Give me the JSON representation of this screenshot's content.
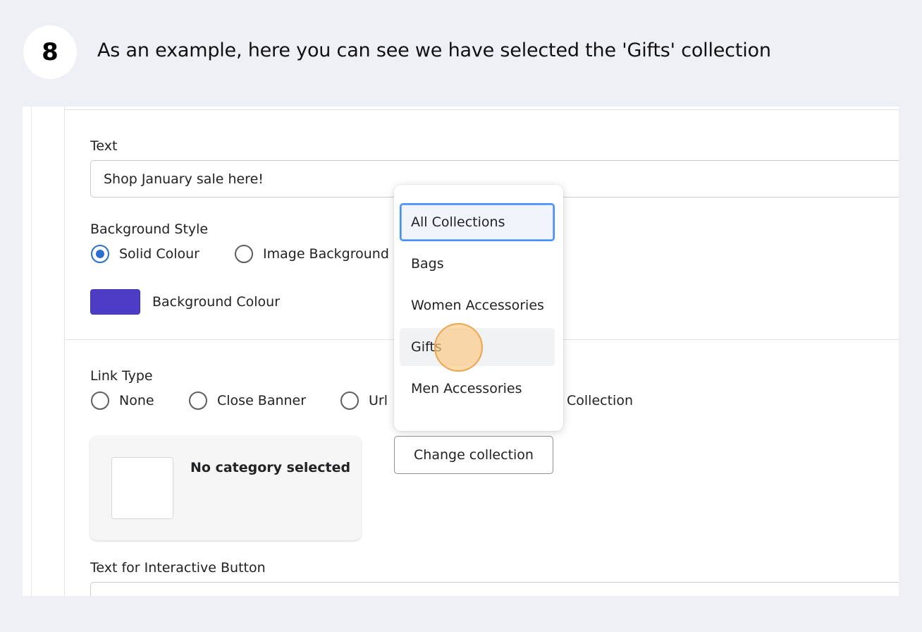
{
  "step": {
    "number": "8",
    "instruction": "As an example, here you can see we have selected the 'Gifts' collection"
  },
  "form": {
    "text_label": "Text",
    "text_value": "Shop January sale here!",
    "background_style_label": "Background Style",
    "background_options": [
      {
        "label": "Solid Colour",
        "checked": true
      },
      {
        "label": "Image Background",
        "checked": false
      }
    ],
    "background_colour_label": "Background Colour",
    "background_colour": "#4d3cc6",
    "link_type_label": "Link Type",
    "link_options": [
      {
        "label": "None",
        "checked": false
      },
      {
        "label": "Close Banner",
        "checked": false
      },
      {
        "label": "Url",
        "checked": false
      },
      {
        "label": "Collection",
        "checked": false
      }
    ],
    "no_category_text": "No category selected",
    "change_collection_label": "Change collection",
    "interactive_button_label": "Text for Interactive Button"
  },
  "dropdown": {
    "items": [
      {
        "label": "All Collections",
        "state": "selected"
      },
      {
        "label": "Bags",
        "state": "normal"
      },
      {
        "label": "Women Accessories",
        "state": "normal"
      },
      {
        "label": "Gifts",
        "state": "hovered"
      },
      {
        "label": "Men Accessories",
        "state": "normal"
      }
    ]
  },
  "colors": {
    "accent": "#2c6ecb",
    "focus_ring": "#458fff",
    "click_indicator": "#f9c882",
    "page_background": "#eef0f5"
  }
}
